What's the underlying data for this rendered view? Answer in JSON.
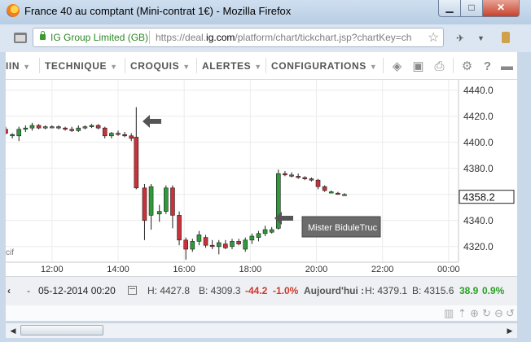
{
  "window": {
    "title": "France 40 au comptant (Mini-contrat 1€) - Mozilla Firefox",
    "min_label": "▁",
    "max_label": "□",
    "close_label": "✕"
  },
  "address": {
    "identity": "IG Group Limited (GB)",
    "url_prefix": "https://deal.",
    "url_domain": "ig.com",
    "url_suffix": "/platform/chart/tickchart.jsp?chartKey=ch"
  },
  "nav": {
    "items": [
      {
        "label": "IIN"
      },
      {
        "label": "TECHNIQUE"
      },
      {
        "label": "CROQUIS"
      },
      {
        "label": "ALERTES"
      },
      {
        "label": "CONFIGURATIONS"
      }
    ],
    "caret": "▼"
  },
  "chart_data": {
    "type": "candlestick",
    "y_ticks": [
      "4440.0",
      "4420.0",
      "4400.0",
      "4380.0",
      "4360.0",
      "4340.0",
      "4320.0"
    ],
    "x_ticks": [
      "12:00",
      "14:00",
      "16:00",
      "18:00",
      "20:00",
      "22:00",
      "00:00"
    ],
    "ylim": [
      4308,
      4448
    ],
    "xlim": [
      10.6,
      24.3
    ],
    "current_price": "4358.2",
    "annotation": "Mister BiduleTruc",
    "partial_label": "cif",
    "colors": {
      "up": "#2f9a3a",
      "down": "#c8323a",
      "grid": "#ececec"
    },
    "candles": [
      {
        "t": 10.6,
        "o": 4410,
        "h": 4412,
        "l": 4406,
        "c": 4407
      },
      {
        "t": 10.8,
        "o": 4405,
        "h": 4407,
        "l": 4403,
        "c": 4406
      },
      {
        "t": 11.0,
        "o": 4405,
        "h": 4412,
        "l": 4401,
        "c": 4410
      },
      {
        "t": 11.2,
        "o": 4410,
        "h": 4413,
        "l": 4408,
        "c": 4411
      },
      {
        "t": 11.4,
        "o": 4411,
        "h": 4415,
        "l": 4409,
        "c": 4413
      },
      {
        "t": 11.6,
        "o": 4413,
        "h": 4414,
        "l": 4410,
        "c": 4411
      },
      {
        "t": 11.8,
        "o": 4411,
        "h": 4413,
        "l": 4410,
        "c": 4412
      },
      {
        "t": 12.0,
        "o": 4412,
        "h": 4413,
        "l": 4411,
        "c": 4412
      },
      {
        "t": 12.2,
        "o": 4412,
        "h": 4413,
        "l": 4410,
        "c": 4411
      },
      {
        "t": 12.4,
        "o": 4411,
        "h": 4412,
        "l": 4409,
        "c": 4410
      },
      {
        "t": 12.6,
        "o": 4410,
        "h": 4412,
        "l": 4408,
        "c": 4409
      },
      {
        "t": 12.8,
        "o": 4409,
        "h": 4413,
        "l": 4408,
        "c": 4411
      },
      {
        "t": 13.0,
        "o": 4411,
        "h": 4413,
        "l": 4410,
        "c": 4412
      },
      {
        "t": 13.2,
        "o": 4412,
        "h": 4414,
        "l": 4411,
        "c": 4413
      },
      {
        "t": 13.4,
        "o": 4413,
        "h": 4414,
        "l": 4410,
        "c": 4411
      },
      {
        "t": 13.6,
        "o": 4411,
        "h": 4412,
        "l": 4403,
        "c": 4405
      },
      {
        "t": 13.8,
        "o": 4405,
        "h": 4408,
        "l": 4403,
        "c": 4407
      },
      {
        "t": 14.0,
        "o": 4407,
        "h": 4409,
        "l": 4405,
        "c": 4406
      },
      {
        "t": 14.2,
        "o": 4406,
        "h": 4408,
        "l": 4404,
        "c": 4405
      },
      {
        "t": 14.4,
        "o": 4405,
        "h": 4407,
        "l": 4401,
        "c": 4403
      },
      {
        "t": 14.55,
        "o": 4404,
        "h": 4427,
        "l": 4364,
        "c": 4365
      },
      {
        "t": 14.8,
        "o": 4365,
        "h": 4368,
        "l": 4325,
        "c": 4340
      },
      {
        "t": 15.0,
        "o": 4344,
        "h": 4368,
        "l": 4333,
        "c": 4366
      },
      {
        "t": 15.25,
        "o": 4345,
        "h": 4352,
        "l": 4339,
        "c": 4347
      },
      {
        "t": 15.45,
        "o": 4347,
        "h": 4367,
        "l": 4345,
        "c": 4365
      },
      {
        "t": 15.65,
        "o": 4365,
        "h": 4367,
        "l": 4334,
        "c": 4344
      },
      {
        "t": 15.85,
        "o": 4344,
        "h": 4347,
        "l": 4321,
        "c": 4325
      },
      {
        "t": 16.05,
        "o": 4325,
        "h": 4327,
        "l": 4310,
        "c": 4318
      },
      {
        "t": 16.25,
        "o": 4318,
        "h": 4326,
        "l": 4316,
        "c": 4324
      },
      {
        "t": 16.45,
        "o": 4324,
        "h": 4332,
        "l": 4321,
        "c": 4329
      },
      {
        "t": 16.65,
        "o": 4327,
        "h": 4329,
        "l": 4319,
        "c": 4321
      },
      {
        "t": 16.85,
        "o": 4321,
        "h": 4325,
        "l": 4318,
        "c": 4320
      },
      {
        "t": 17.05,
        "o": 4320,
        "h": 4325,
        "l": 4314,
        "c": 4323
      },
      {
        "t": 17.25,
        "o": 4322,
        "h": 4325,
        "l": 4318,
        "c": 4319
      },
      {
        "t": 17.45,
        "o": 4320,
        "h": 4326,
        "l": 4318,
        "c": 4324
      },
      {
        "t": 17.65,
        "o": 4324,
        "h": 4326,
        "l": 4321,
        "c": 4322
      },
      {
        "t": 17.85,
        "o": 4318,
        "h": 4327,
        "l": 4316,
        "c": 4325
      },
      {
        "t": 18.05,
        "o": 4325,
        "h": 4330,
        "l": 4322,
        "c": 4328
      },
      {
        "t": 18.25,
        "o": 4327,
        "h": 4332,
        "l": 4324,
        "c": 4330
      },
      {
        "t": 18.45,
        "o": 4330,
        "h": 4336,
        "l": 4328,
        "c": 4333
      },
      {
        "t": 18.65,
        "o": 4331,
        "h": 4335,
        "l": 4330,
        "c": 4333
      },
      {
        "t": 18.85,
        "o": 4334,
        "h": 4379,
        "l": 4333,
        "c": 4376
      },
      {
        "t": 19.05,
        "o": 4376,
        "h": 4378,
        "l": 4374,
        "c": 4375
      },
      {
        "t": 19.25,
        "o": 4375,
        "h": 4377,
        "l": 4373,
        "c": 4374
      },
      {
        "t": 19.45,
        "o": 4374,
        "h": 4376,
        "l": 4372,
        "c": 4373
      },
      {
        "t": 19.65,
        "o": 4373,
        "h": 4374,
        "l": 4371,
        "c": 4372
      },
      {
        "t": 19.85,
        "o": 4372,
        "h": 4373,
        "l": 4370,
        "c": 4371
      },
      {
        "t": 20.05,
        "o": 4371,
        "h": 4372,
        "l": 4364,
        "c": 4366
      },
      {
        "t": 20.25,
        "o": 4366,
        "h": 4367,
        "l": 4362,
        "c": 4363
      },
      {
        "t": 20.45,
        "o": 4362,
        "h": 4363,
        "l": 4361,
        "c": 4362
      },
      {
        "t": 20.65,
        "o": 4361,
        "h": 4362,
        "l": 4360,
        "c": 4360
      },
      {
        "t": 20.85,
        "o": 4360,
        "h": 4361,
        "l": 4359,
        "c": 4360
      }
    ]
  },
  "status": {
    "expand": "‹",
    "dash": "-",
    "datetime": "05-12-2014 00:20",
    "high": "H: 4427.8",
    "low": "B: 4309.3",
    "change": "-44.2",
    "change_pct": "-1.0%",
    "today_label": "Aujourd'hui :",
    "today_high": "H: 4379.1",
    "today_low": "B: 4315.6",
    "today_change": "38.9",
    "today_change_pct": "0.9%"
  }
}
